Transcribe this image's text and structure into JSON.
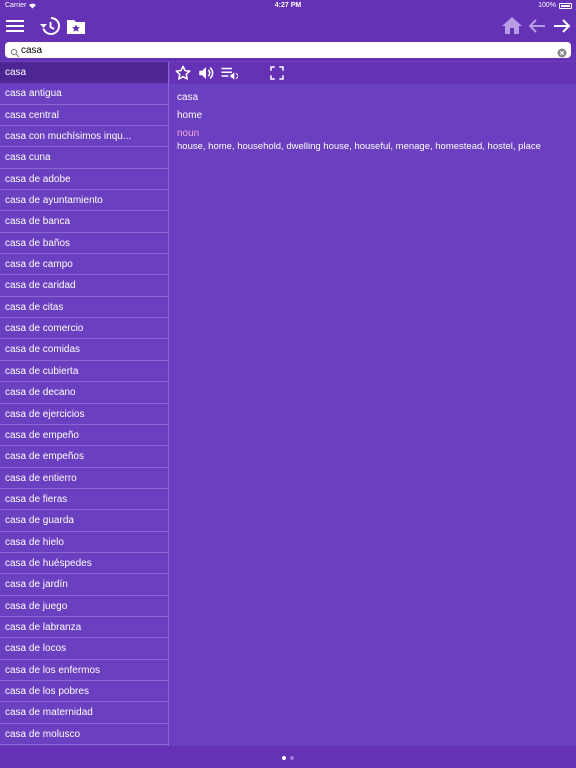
{
  "status_bar": {
    "carrier": "Carrier",
    "time": "4:27 PM",
    "battery": "100%"
  },
  "search": {
    "value": "casa",
    "placeholder": ""
  },
  "word_list": [
    "casa",
    "casa antigua",
    "casa central",
    "casa con muchísimos inqu...",
    "casa cuna",
    "casa de adobe",
    "casa de ayuntamiento",
    "casa de banca",
    "casa de baños",
    "casa de campo",
    "casa de caridad",
    "casa de citas",
    "casa de comercio",
    "casa de comidas",
    "casa de cubierta",
    "casa de decano",
    "casa de ejercicios",
    "casa de empeño",
    "casa de empeños",
    "casa de entierro",
    "casa de fieras",
    "casa de guarda",
    "casa de hielo",
    "casa de huéspedes",
    "casa de jardín",
    "casa de juego",
    "casa de labranza",
    "casa de locos",
    "casa de los enfermos",
    "casa de los pobres",
    "casa de maternidad",
    "casa de molusco"
  ],
  "selected_index": 0,
  "entry": {
    "headword": "casa",
    "translation": "home",
    "part_of_speech": "noun",
    "meanings": "house, home, household, dwelling house, houseful, menage, homestead, hostel, place"
  },
  "icons": {
    "menu": "menu-icon",
    "history": "history-icon",
    "favorites": "favorites-folder-icon",
    "home": "home-icon",
    "back": "arrow-left-icon",
    "forward": "arrow-right-icon",
    "star": "star-icon",
    "speaker": "speaker-icon",
    "playlist": "playlist-audio-icon",
    "fullscreen": "fullscreen-icon"
  },
  "colors": {
    "background": "#6a3fc0",
    "toolbar": "#6532b6",
    "selected_row": "#4d2694",
    "part_of_speech": "#f0a8e0"
  },
  "pagination": {
    "pages": 2,
    "current": 1
  }
}
